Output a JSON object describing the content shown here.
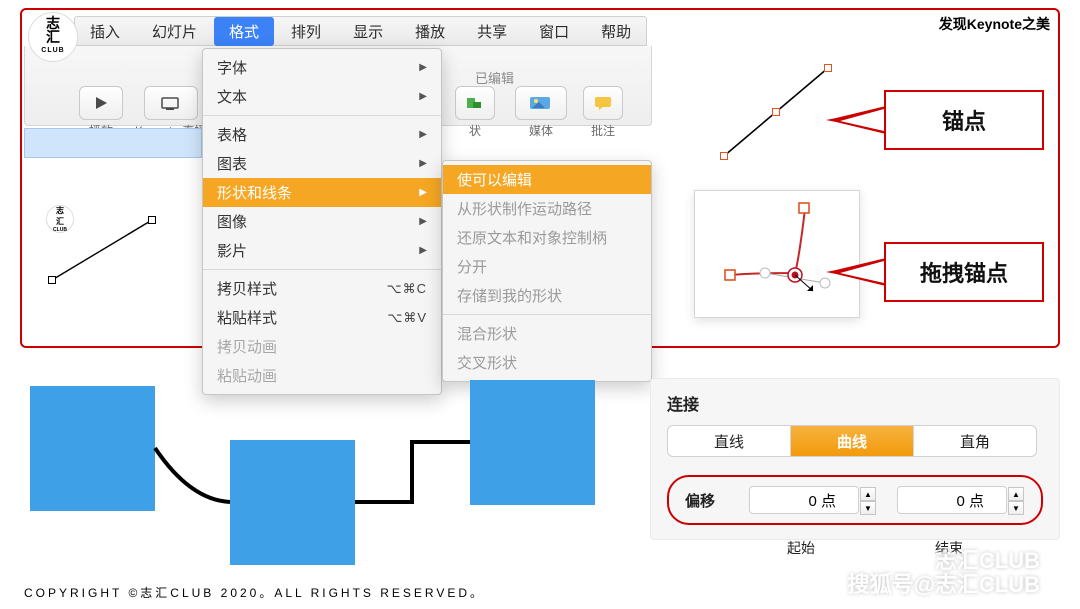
{
  "tagline": "发现Keynote之美",
  "menubar": [
    "插入",
    "幻灯片",
    "格式",
    "排列",
    "显示",
    "播放",
    "共享",
    "窗口",
    "帮助"
  ],
  "menubar_active_index": 2,
  "toolbar": {
    "play": "播放",
    "keynote_live": "Keynote 直播",
    "edited": "已编辑",
    "shape": "状",
    "media": "媒体",
    "comment": "批注"
  },
  "dropdown": {
    "items": [
      {
        "label": "字体",
        "type": "sub"
      },
      {
        "label": "文本",
        "type": "sub"
      },
      {
        "type": "sep"
      },
      {
        "label": "表格",
        "type": "sub"
      },
      {
        "label": "图表",
        "type": "sub"
      },
      {
        "label": "形状和线条",
        "type": "sub",
        "highlight": true
      },
      {
        "label": "图像",
        "type": "sub"
      },
      {
        "label": "影片",
        "type": "sub"
      },
      {
        "type": "sep"
      },
      {
        "label": "拷贝样式",
        "shortcut": "⌥⌘C"
      },
      {
        "label": "粘贴样式",
        "shortcut": "⌥⌘V"
      },
      {
        "label": "拷贝动画",
        "disabled": true
      },
      {
        "label": "粘贴动画",
        "disabled": true
      }
    ]
  },
  "submenu": {
    "items": [
      {
        "label": "使可以编辑",
        "highlight": true
      },
      {
        "label": "从形状制作运动路径",
        "disabled": true
      },
      {
        "label": "还原文本和对象控制柄",
        "disabled": true
      },
      {
        "label": "分开",
        "disabled": true
      },
      {
        "label": "存储到我的形状",
        "disabled": true
      },
      {
        "type": "sep"
      },
      {
        "label": "混合形状",
        "disabled": true
      },
      {
        "label": "交叉形状",
        "disabled": true
      }
    ]
  },
  "callouts": {
    "anchor": "锚点",
    "drag_anchor": "拖拽锚点"
  },
  "panel": {
    "title": "连接",
    "segments": [
      "直线",
      "曲线",
      "直角"
    ],
    "active_segment_index": 1,
    "offset_label": "偏移",
    "start_value": "0 点",
    "end_value": "0 点",
    "start_caption": "起始",
    "end_caption": "结束"
  },
  "footer": "COPYRIGHT ©志汇CLUB 2020。ALL RIGHTS RESERVED。",
  "watermarks": {
    "line1": "志汇CLUB",
    "line2": "搜狐号@志汇CLUB"
  },
  "logo": {
    "l1": "志",
    "l2": "汇",
    "club": "CLUB"
  }
}
